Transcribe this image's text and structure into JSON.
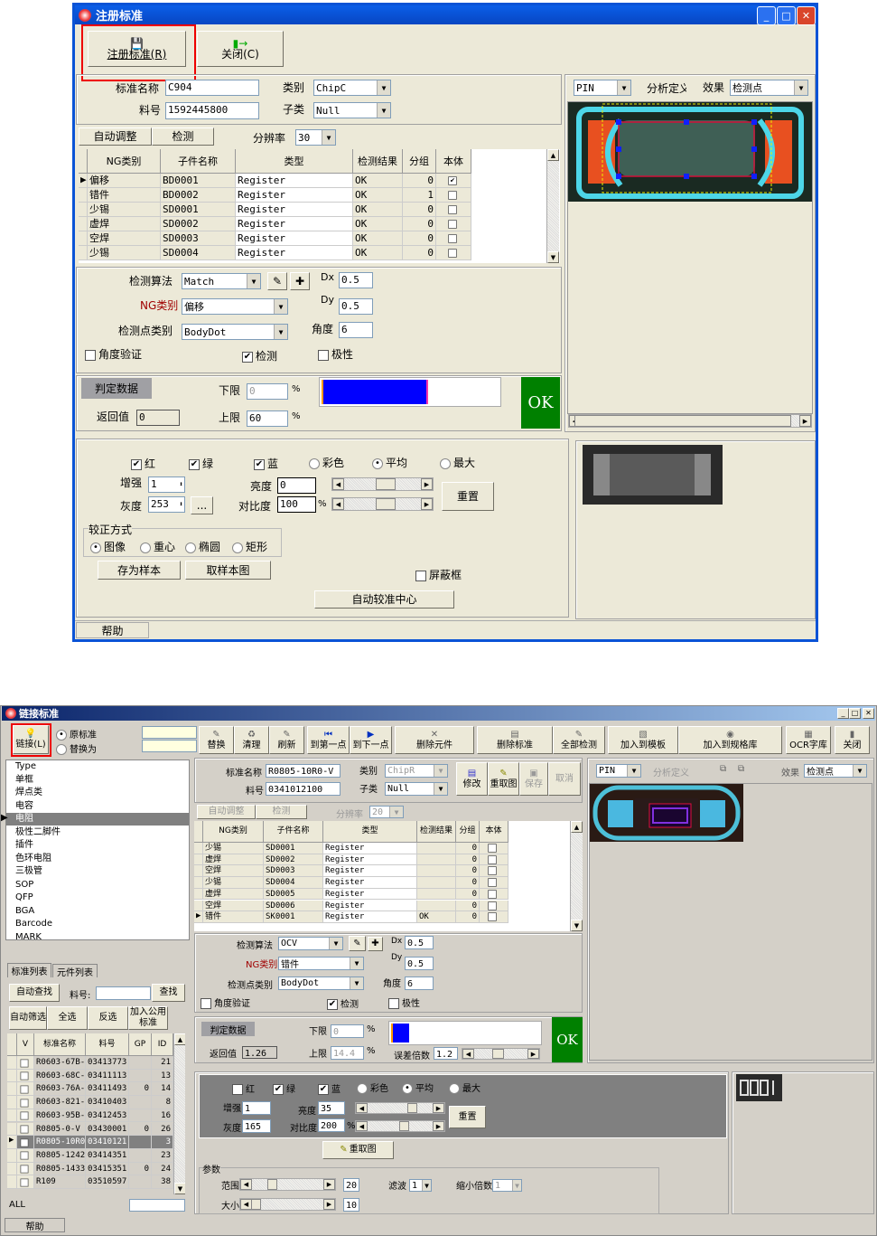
{
  "top": {
    "title": "注册标准",
    "toolbar": {
      "register": "注册标准(R)",
      "close": "关闭(C)"
    },
    "fields": {
      "std_name_label": "标准名称",
      "std_name": "C904",
      "part_no_label": "料号",
      "part_no": "1592445800",
      "category_label": "类别",
      "category": "ChipC",
      "subcategory_label": "子类",
      "subcategory": "Null"
    },
    "row2": {
      "auto_adjust": "自动调整",
      "detect": "检测",
      "resolution_label": "分辨率",
      "resolution": "30"
    },
    "grid": {
      "headers": [
        "NG类别",
        "子件名称",
        "类型",
        "检测结果",
        "分组",
        "本体"
      ],
      "rows": [
        [
          "偏移",
          "BD0001",
          "Register",
          "OK",
          "0",
          true
        ],
        [
          "错件",
          "BD0002",
          "Register",
          "OK",
          "1",
          false
        ],
        [
          "少锡",
          "SD0001",
          "Register",
          "OK",
          "0",
          false
        ],
        [
          "虚焊",
          "SD0002",
          "Register",
          "OK",
          "0",
          false
        ],
        [
          "空焊",
          "SD0003",
          "Register",
          "OK",
          "0",
          false
        ],
        [
          "少锡",
          "SD0004",
          "Register",
          "OK",
          "0",
          false
        ]
      ],
      "selected": 0
    },
    "params": {
      "algo_label": "检测算法",
      "algo": "Match",
      "ng_label": "NG类别",
      "ng": "偏移",
      "point_label": "检测点类别",
      "point": "BodyDot",
      "dx_label": "Dx",
      "dx": "0.5",
      "dy_label": "Dy",
      "dy": "0.5",
      "angle_label": "角度",
      "angle": "6",
      "angle_verify": "角度验证",
      "detect": "检测",
      "polarity": "极性"
    },
    "judge": {
      "badge": "判定数据",
      "return_label": "返回值",
      "return_value": "0",
      "lower_label": "下限",
      "lower": "0",
      "upper_label": "上限",
      "upper": "60",
      "pct": "%",
      "bar_fraction": 0.6,
      "result": "OK"
    },
    "view": {
      "pin": "PIN",
      "analysis": "分析定义",
      "effect_label": "效果",
      "effect": "检测点"
    },
    "image_adj": {
      "red": "红",
      "green": "绿",
      "blue": "蓝",
      "color": "彩色",
      "average": "平均",
      "max": "最大",
      "enhance_label": "增强",
      "enhance": "1",
      "gray_label": "灰度",
      "gray": "253",
      "more": "...",
      "brightness_label": "亮度",
      "brightness": "0",
      "contrast_label": "对比度",
      "contrast": "100",
      "pct": "%",
      "reset": "重置"
    },
    "calib": {
      "title": "较正方式",
      "image": "图像",
      "centroid": "重心",
      "ellipse": "椭圆",
      "rect": "矩形",
      "save_sample": "存为样本",
      "get_sample": "取样本图",
      "mask": "屏蔽框",
      "auto_center": "自动较准中心"
    },
    "status": {
      "help": "帮助"
    }
  },
  "bottom": {
    "title": "链接标准",
    "toolbar": {
      "link": "链接(L)",
      "orig": "原标准",
      "replace_with": "替换为",
      "buttons": [
        "替换",
        "清理",
        "刷新",
        "到第一点",
        "到下一点",
        "删除元件",
        "删除标准",
        "全部检测",
        "加入到模板",
        "加入到规格库",
        "OCR字库",
        "关闭"
      ]
    },
    "types": [
      "Type",
      "单框",
      "焊点类",
      "电容",
      "电阻",
      "极性二脚件",
      "插件",
      "色环电阻",
      "三极管",
      "SOP",
      "QFP",
      "BGA",
      "Barcode",
      "MARK"
    ],
    "types_selected": 4,
    "tabs": [
      "标准列表",
      "元件列表"
    ],
    "search": {
      "auto_find": "自动查找",
      "part_label": "料号:",
      "part": "",
      "find": "查找",
      "auto_filter": "自动筛选",
      "select_all": "全选",
      "invert": "反选",
      "add_common": "加入公用标准"
    },
    "std_grid": {
      "headers": [
        "V",
        "标准名称",
        "料号",
        "GP",
        "ID"
      ],
      "rows": [
        [
          "R0603-67B-",
          "03413773",
          "",
          "21"
        ],
        [
          "R0603-68C-",
          "03411113",
          "",
          "13"
        ],
        [
          "R0603-76A-",
          "03411493",
          "0",
          "14"
        ],
        [
          "R0603-821-",
          "03410403",
          "",
          "8"
        ],
        [
          "R0603-95B-",
          "03412453",
          "",
          "16"
        ],
        [
          "R0805-0-V",
          "03430001",
          "0",
          "26"
        ],
        [
          "R0805-10R0",
          "03410121",
          "",
          "3"
        ],
        [
          "R0805-1242",
          "03414351",
          "",
          "23"
        ],
        [
          "R0805-1433",
          "03415351",
          "0",
          "24"
        ],
        [
          "R109",
          "03510597",
          "",
          "38"
        ]
      ],
      "selected": 6
    },
    "all_label": "ALL",
    "fields": {
      "std_name_label": "标准名称",
      "std_name": "R0805-10R0-V",
      "part_no_label": "料号",
      "part_no": "0341012100",
      "category_label": "类别",
      "category": "ChipR",
      "subcategory_label": "子类",
      "subcategory": "Null",
      "modify": "修改",
      "regrab": "重取图",
      "save": "保存",
      "cancel": "取消"
    },
    "row2": {
      "auto_adjust": "自动调整",
      "detect": "检测",
      "resolution_label": "分辨率",
      "resolution": "20"
    },
    "grid": {
      "headers": [
        "NG类别",
        "子件名称",
        "类型",
        "检测结果",
        "分组",
        "本体"
      ],
      "rows": [
        [
          "少锡",
          "SD0001",
          "Register",
          "",
          "0",
          false
        ],
        [
          "虚焊",
          "SD0002",
          "Register",
          "",
          "0",
          false
        ],
        [
          "空焊",
          "SD0003",
          "Register",
          "",
          "0",
          false
        ],
        [
          "少锡",
          "SD0004",
          "Register",
          "",
          "0",
          false
        ],
        [
          "虚焊",
          "SD0005",
          "Register",
          "",
          "0",
          false
        ],
        [
          "空焊",
          "SD0006",
          "Register",
          "",
          "0",
          false
        ],
        [
          "错件",
          "SK0001",
          "Register",
          "OK",
          "0",
          false
        ]
      ],
      "selected": 6
    },
    "params": {
      "algo_label": "检测算法",
      "algo": "OCV",
      "ng_label": "NG类别",
      "ng": "错件",
      "point_label": "检测点类别",
      "point": "BodyDot",
      "dx_label": "Dx",
      "dx": "0.5",
      "dy_label": "Dy",
      "dy": "0.5",
      "angle_label": "角度",
      "angle": "6",
      "angle_verify": "角度验证",
      "detect": "检测",
      "polarity": "极性"
    },
    "judge": {
      "badge": "判定数据",
      "return_label": "返回值",
      "return_value": "1.26",
      "lower_label": "下限",
      "lower": "0",
      "upper_label": "上限",
      "upper": "14.4",
      "pct": "%",
      "error_label": "误差倍数",
      "error": "1.2",
      "bar_fraction": 0.12,
      "result": "OK"
    },
    "view": {
      "pin": "PIN",
      "analysis": "分析定义",
      "effect_label": "效果",
      "effect": "检测点"
    },
    "image_adj": {
      "red": "红",
      "green": "绿",
      "blue": "蓝",
      "color": "彩色",
      "average": "平均",
      "max": "最大",
      "enhance_label": "增强",
      "enhance": "1",
      "gray_label": "灰度",
      "gray": "165",
      "brightness_label": "亮度",
      "brightness": "35",
      "contrast_label": "对比度",
      "contrast": "200",
      "pct": "%",
      "reset": "重置",
      "regrab": "重取图"
    },
    "param_group": {
      "title": "参数",
      "range_label": "范围",
      "range": "20",
      "size_label": "大小",
      "size": "10",
      "filter_label": "滤波",
      "filter": "1",
      "shrink_label": "缩小倍数",
      "shrink": "1"
    },
    "status": {
      "help": "帮助"
    }
  },
  "colors": {
    "ok_green": "#008000",
    "bar_blue": "#0000ff",
    "highlight": "#e00000"
  }
}
